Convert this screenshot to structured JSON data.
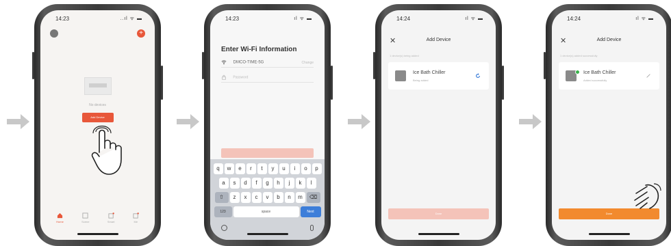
{
  "colors": {
    "accent": "#e8573a",
    "accent_disabled": "#f4c3b9",
    "done_active": "#f28a2e",
    "success": "#38b24a",
    "key_blue": "#3d7ed9",
    "arrow": "#c8c8c8"
  },
  "icons": [
    "arrow-right-icon",
    "hand-tap-icon",
    "wifi-icon",
    "lock-icon",
    "close-icon",
    "refresh-icon",
    "edit-icon",
    "check-icon",
    "home-icon",
    "scene-icon",
    "smart-icon",
    "profile-icon",
    "emoji-icon",
    "mic-icon"
  ],
  "phone1": {
    "time": "14:23",
    "status_icons": "..ıl ᯤ ▬",
    "no_device_text": "No devices",
    "add_button": "Add Device",
    "tabs": [
      {
        "label": "Home",
        "icon": "home-icon"
      },
      {
        "label": "Scene",
        "icon": "scene-icon"
      },
      {
        "label": "Smart",
        "icon": "smart-icon"
      },
      {
        "label": "Me",
        "icon": "profile-icon"
      }
    ]
  },
  "phone2": {
    "time": "14:23",
    "status_icons": "ıl ᯤ ▬",
    "title": "Enter Wi-Fi Information",
    "wifi_name": "DMCO-TIME-5G",
    "wifi_switch": "Change",
    "password_placeholder": "Password",
    "keyboard": {
      "row1": [
        "q",
        "w",
        "e",
        "r",
        "t",
        "y",
        "u",
        "i",
        "o",
        "p"
      ],
      "row2": [
        "a",
        "s",
        "d",
        "f",
        "g",
        "h",
        "j",
        "k",
        "l"
      ],
      "row3": [
        "z",
        "x",
        "c",
        "v",
        "b",
        "n",
        "m"
      ],
      "shift": "⇧",
      "backspace": "⌫",
      "numbers": "123",
      "space": "space",
      "go": "Next"
    }
  },
  "phone3": {
    "time": "14:24",
    "status_icons": "ıl ᯤ ▬",
    "close": "✕",
    "title": "Add Device",
    "hint": "1 device(s) being added",
    "device_name": "Ice Bath Chiller",
    "device_status": "Being added",
    "button": "Done"
  },
  "phone4": {
    "time": "14:24",
    "status_icons": "ıl ᯤ ▬",
    "close": "✕",
    "title": "Add Device",
    "hint": "1 device(s) added successfully",
    "device_name": "Ice Bath Chiller",
    "device_status": "Added successfully",
    "button": "Done"
  }
}
